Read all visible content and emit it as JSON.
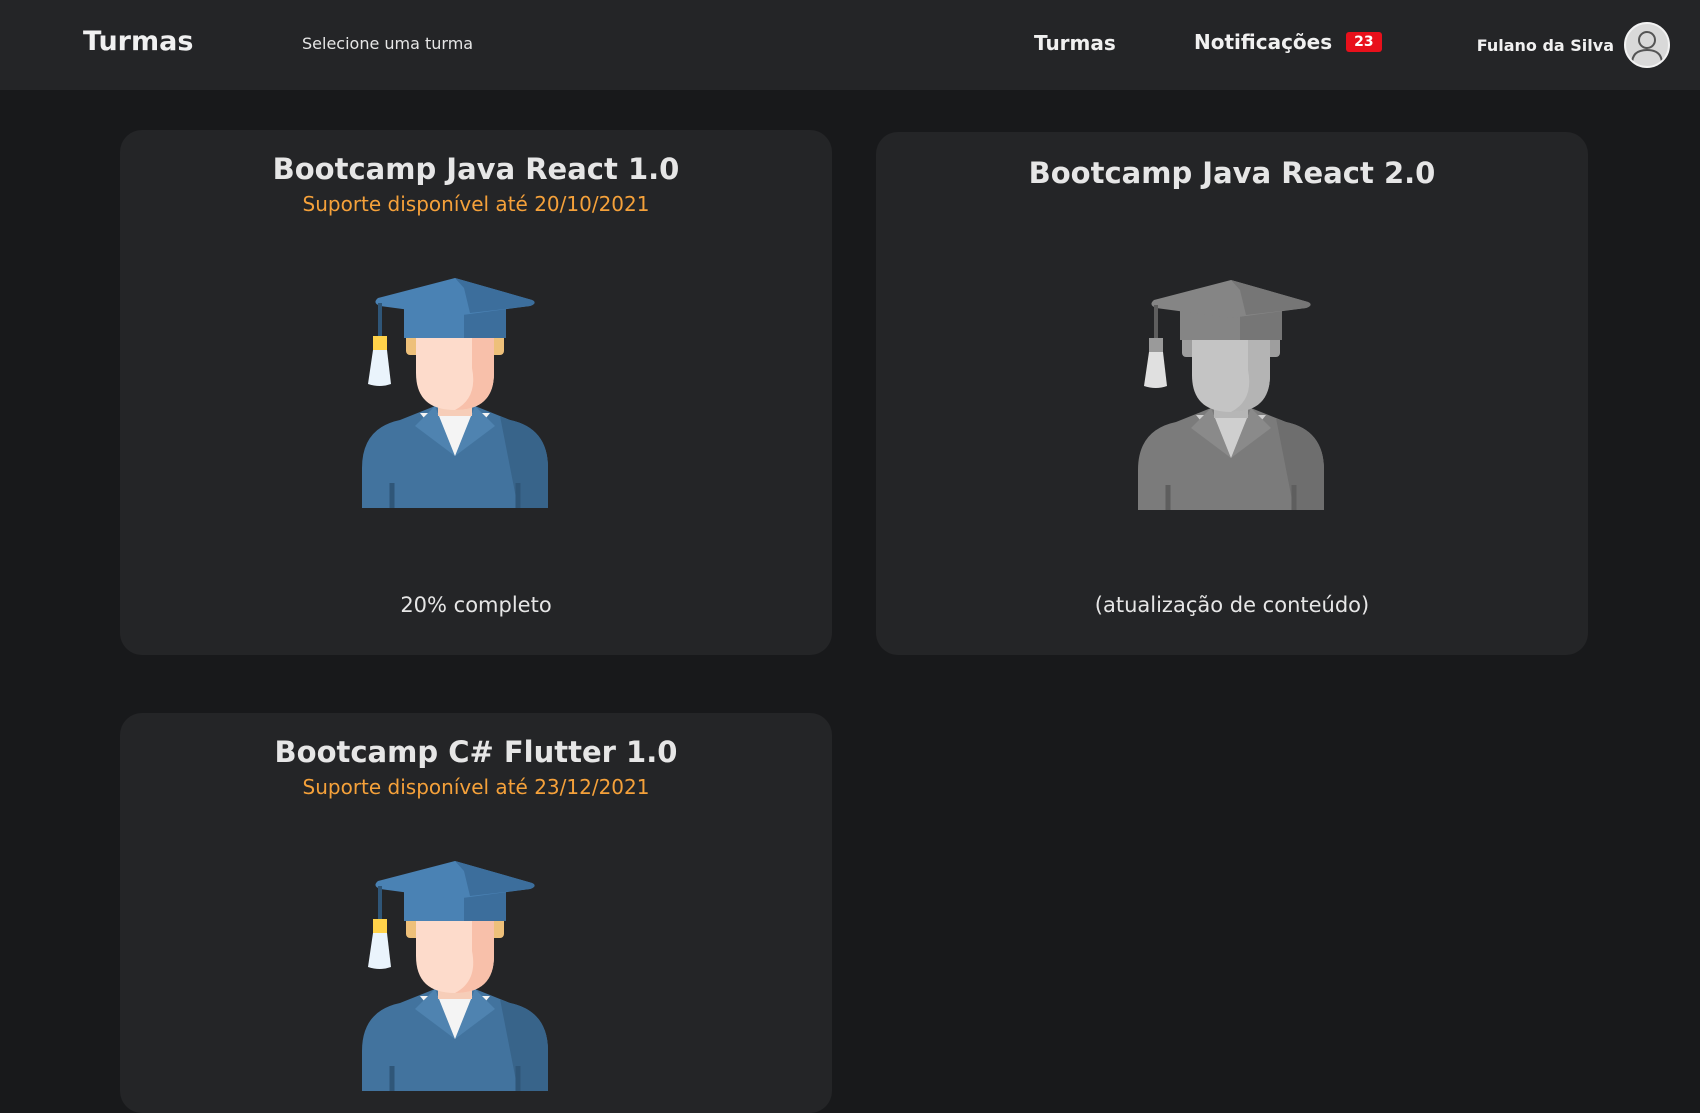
{
  "header": {
    "brand": "Turmas",
    "subtitle": "Selecione uma turma",
    "nav_turmas": "Turmas",
    "nav_notifications": "Notificações",
    "notification_count": "23",
    "user_name": "Fulano da Silva"
  },
  "colors": {
    "background": "#18191b",
    "surface": "#242527",
    "accent_orange": "#f5a13a",
    "badge_red": "#e8101b"
  },
  "courses": [
    {
      "title": "Bootcamp Java React 1.0",
      "support": "Suporte disponível até 20/10/2021",
      "footer": "20% completo",
      "icon": "graduate-icon",
      "active": true
    },
    {
      "title": "Bootcamp Java React 2.0",
      "support": "",
      "footer": "(atualização de conteúdo)",
      "icon": "graduate-icon",
      "active": false
    },
    {
      "title": "Bootcamp C# Flutter 1.0",
      "support": "Suporte disponível até 23/12/2021",
      "footer": "",
      "icon": "graduate-icon",
      "active": true
    }
  ]
}
